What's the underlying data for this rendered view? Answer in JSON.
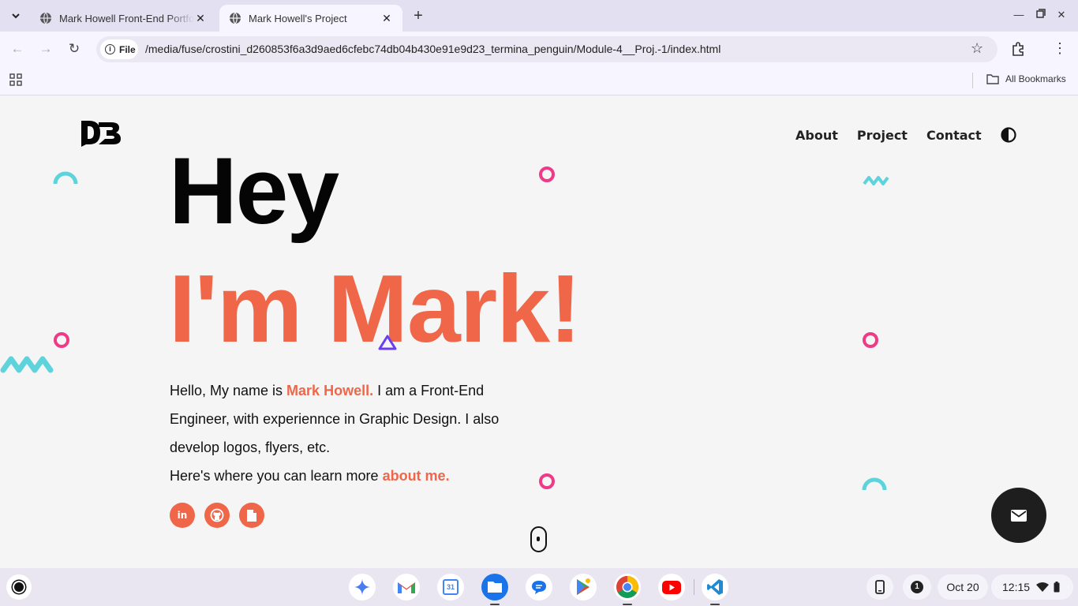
{
  "browser": {
    "tabs": [
      {
        "title": "Mark Howell Front-End Portfolio",
        "active": false
      },
      {
        "title": "Mark Howell's Project",
        "active": true
      }
    ],
    "omnibox": {
      "chip_label": "File",
      "url": "/media/fuse/crostini_d260853f6a3d9aed6cfebc74db04b430e91e9d23_termina_penguin/Module-4__Proj.-1/index.html"
    },
    "bookmarks": {
      "all_label": "All Bookmarks"
    }
  },
  "site": {
    "logo_icon": "mb-logo-icon",
    "nav": [
      "About",
      "Project",
      "Contact"
    ],
    "theme_icon": "half-circle-contrast-icon",
    "headline_1": "Hey",
    "headline_2": "I'm Mark!",
    "bio": {
      "intro": "Hello, My name is ",
      "name": "Mark Howell.",
      "rest": " I am a Front-End Engineer, with experiennce in Graphic Design. I also develop logos, flyers, etc.",
      "line2_prefix": "Here's where you can learn more ",
      "line2_link": "about me."
    },
    "socials": [
      "linkedin-icon",
      "github-icon",
      "resume-file-icon"
    ],
    "fab_icon": "envelope-icon",
    "accent_color": "#ef6649",
    "deco_pink": "#ef3a88",
    "deco_teal": "#5fd3dc",
    "deco_purple": "#6a3ff0"
  },
  "shelf": {
    "apps": [
      "gemini",
      "gmail",
      "calendar",
      "files",
      "messages",
      "play-store",
      "chrome",
      "youtube",
      "vscode"
    ],
    "calendar_day": "31",
    "notification_count": "1",
    "date": "Oct 20",
    "time": "12:15"
  }
}
